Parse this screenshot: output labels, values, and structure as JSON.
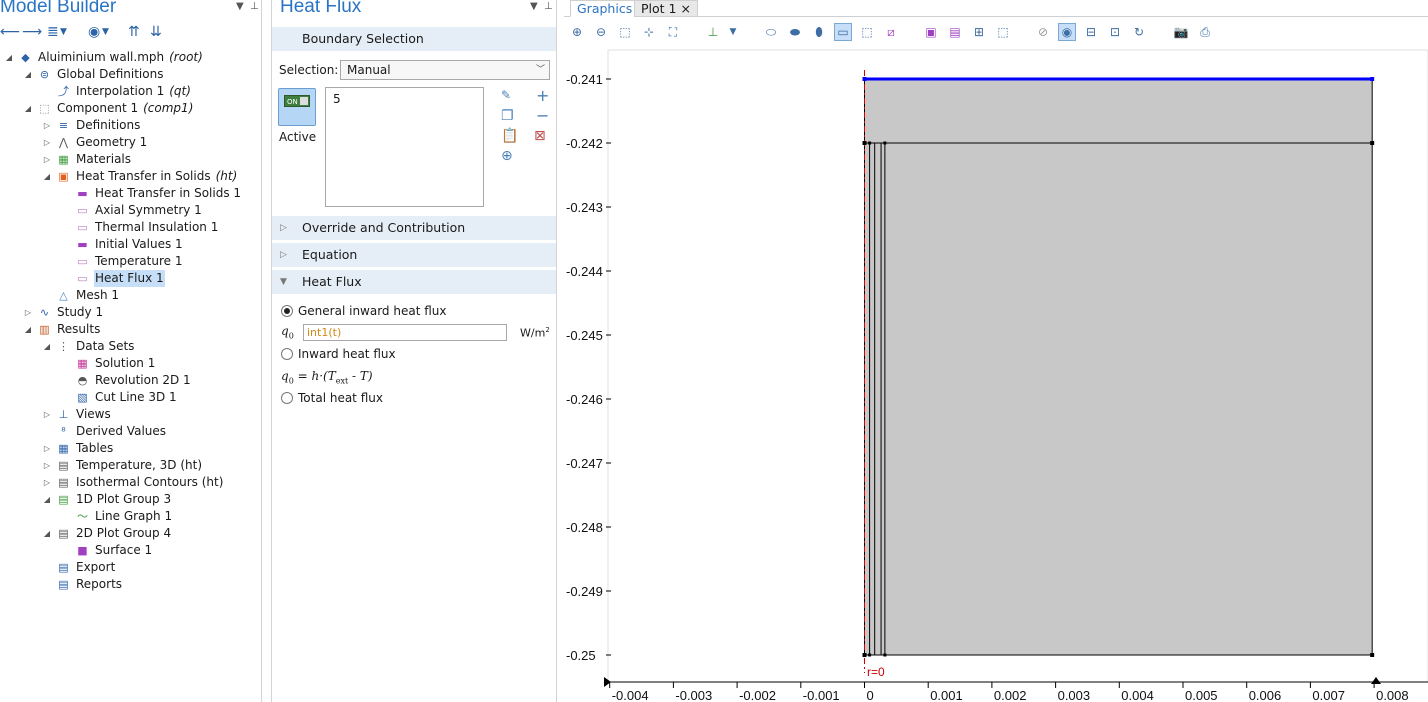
{
  "model_builder": {
    "title": "Model Builder",
    "tree": [
      {
        "label": "Aluiminium wall.mph",
        "suffix": "(root)",
        "icon": "model-icon",
        "color": "#2b62a8",
        "twisty": "open"
      },
      {
        "label": "Global Definitions",
        "icon": "global-definitions-icon",
        "color": "#2b62a8",
        "twisty": "open"
      },
      {
        "label": "Interpolation 1",
        "suffix": "(qt)",
        "icon": "interpolation-icon",
        "color": "#2b62a8",
        "twisty": ""
      },
      {
        "label": "Component 1",
        "suffix": "(comp1)",
        "icon": "component-icon",
        "color": "#888888",
        "twisty": "open"
      },
      {
        "label": "Definitions",
        "icon": "definitions-icon",
        "color": "#2b62a8",
        "twisty": "closed"
      },
      {
        "label": "Geometry 1",
        "icon": "geometry-icon",
        "color": "#555555",
        "twisty": "closed"
      },
      {
        "label": "Materials",
        "icon": "materials-icon",
        "color": "#3c9a3c",
        "twisty": "closed"
      },
      {
        "label": "Heat Transfer in Solids",
        "suffix": "(ht)",
        "icon": "heat-transfer-icon",
        "color": "#e06020",
        "twisty": "open"
      },
      {
        "label": "Heat Transfer in Solids 1",
        "icon": "domain-feature-icon",
        "color": "#a040c0",
        "twisty": ""
      },
      {
        "label": "Axial Symmetry 1",
        "icon": "boundary-feature-icon",
        "color": "#c080c0",
        "twisty": ""
      },
      {
        "label": "Thermal Insulation 1",
        "icon": "boundary-feature-icon",
        "color": "#c080c0",
        "twisty": ""
      },
      {
        "label": "Initial Values 1",
        "icon": "domain-feature-icon",
        "color": "#a040c0",
        "twisty": ""
      },
      {
        "label": "Temperature 1",
        "icon": "boundary-feature-icon",
        "color": "#c080c0",
        "twisty": ""
      },
      {
        "label": "Heat Flux 1",
        "icon": "boundary-feature-icon",
        "color": "#c080c0",
        "twisty": "",
        "selected": true
      },
      {
        "label": "Mesh 1",
        "icon": "mesh-icon",
        "color": "#4a7fb6",
        "twisty": ""
      },
      {
        "label": "Study 1",
        "icon": "study-icon",
        "color": "#2b62a8",
        "twisty": "closed"
      },
      {
        "label": "Results",
        "icon": "results-icon",
        "color": "#c05a20",
        "twisty": "open"
      },
      {
        "label": "Data Sets",
        "icon": "data-sets-icon",
        "color": "#555555",
        "twisty": "open"
      },
      {
        "label": "Solution 1",
        "icon": "solution-icon",
        "color": "#c03090",
        "twisty": ""
      },
      {
        "label": "Revolution 2D 1",
        "icon": "revolution-icon",
        "color": "#555555",
        "twisty": ""
      },
      {
        "label": "Cut Line 3D 1",
        "icon": "cut-line-icon",
        "color": "#2b62a8",
        "twisty": ""
      },
      {
        "label": "Views",
        "icon": "views-icon",
        "color": "#2b62a8",
        "twisty": "closed"
      },
      {
        "label": "Derived Values",
        "icon": "derived-values-icon",
        "color": "#2b62a8",
        "twisty": ""
      },
      {
        "label": "Tables",
        "icon": "tables-icon",
        "color": "#2b62a8",
        "twisty": "closed"
      },
      {
        "label": "Temperature, 3D (ht)",
        "icon": "plot-group-3d-icon",
        "color": "#555555",
        "twisty": "closed"
      },
      {
        "label": "Isothermal Contours (ht)",
        "icon": "plot-group-3d-icon",
        "color": "#555555",
        "twisty": "closed"
      },
      {
        "label": "1D Plot Group 3",
        "icon": "plot-group-1d-icon",
        "color": "#3c9a3c",
        "twisty": "open"
      },
      {
        "label": "Line Graph 1",
        "icon": "line-graph-icon",
        "color": "#3c9a3c",
        "twisty": ""
      },
      {
        "label": "2D Plot Group 4",
        "icon": "plot-group-2d-icon",
        "color": "#555555",
        "twisty": "open"
      },
      {
        "label": "Surface 1",
        "icon": "surface-icon",
        "color": "#a040c0",
        "twisty": ""
      },
      {
        "label": "Export",
        "icon": "export-icon",
        "color": "#2b62a8",
        "twisty": ""
      },
      {
        "label": "Reports",
        "icon": "reports-icon",
        "color": "#2b62a8",
        "twisty": ""
      }
    ]
  },
  "settings": {
    "title": "Heat Flux",
    "boundary_selection": {
      "header": "Boundary Selection",
      "selection_label": "Selection:",
      "selection_value": "Manual",
      "active_toggle": "ON",
      "active_label": "Active",
      "selected_items": [
        "5"
      ]
    },
    "sections": {
      "override": "Override and Contribution",
      "equation": "Equation",
      "heat_flux": "Heat Flux"
    },
    "heat_flux": {
      "option_general": "General inward heat flux",
      "q0_symbol": "q",
      "q0_sub": "0",
      "q0_value": "int1(t)",
      "unit": "W/m",
      "unit_sup": "2",
      "option_inward": "Inward heat flux",
      "formula": {
        "lhs": "q",
        "lhs_sub": "0",
        "eq": " = h·(T",
        "ext": "ext",
        "tail": " - T)"
      },
      "option_total": "Total heat flux",
      "selected_option": "general"
    }
  },
  "graphics": {
    "tabs": [
      {
        "label": "Graphics",
        "active": true
      },
      {
        "label": "Plot 1",
        "close": "×",
        "active": false
      }
    ],
    "colors": {
      "domain_fill": "#c8c8c8",
      "highlight_boundary": "#0000ff",
      "axis_line": "#d00000"
    },
    "axis_label": "r=0"
  },
  "chart_data": {
    "type": "diagram",
    "y_ticks": [
      -0.241,
      -0.242,
      -0.243,
      -0.244,
      -0.245,
      -0.246,
      -0.247,
      -0.248,
      -0.249,
      -0.25
    ],
    "y_tick_labels": [
      "-0.241",
      "-0.242",
      "-0.243",
      "-0.244",
      "-0.245",
      "-0.246",
      "-0.247",
      "-0.248",
      "-0.249",
      "-0.25"
    ],
    "x_ticks": [
      -0.004,
      -0.003,
      -0.002,
      -0.001,
      0,
      0.001,
      0.002,
      0.003,
      0.004,
      0.005,
      0.006,
      0.007,
      0.008
    ],
    "x_tick_labels": [
      "-0.004",
      "-0.003",
      "-0.002",
      "-0.001",
      "0",
      "0.001",
      "0.002",
      "0.003",
      "0.004",
      "0.005",
      "0.006",
      "0.007",
      "0.008"
    ],
    "geometry": {
      "r_min": 0,
      "r_max": 0.00797,
      "z_top": -0.241,
      "z_mid": -0.242,
      "z_bottom": -0.25,
      "thin_layers_r": [
        8e-05,
        0.00016,
        0.00026,
        0.00032
      ]
    },
    "selected_boundary": "z = -0.241 (top)"
  }
}
